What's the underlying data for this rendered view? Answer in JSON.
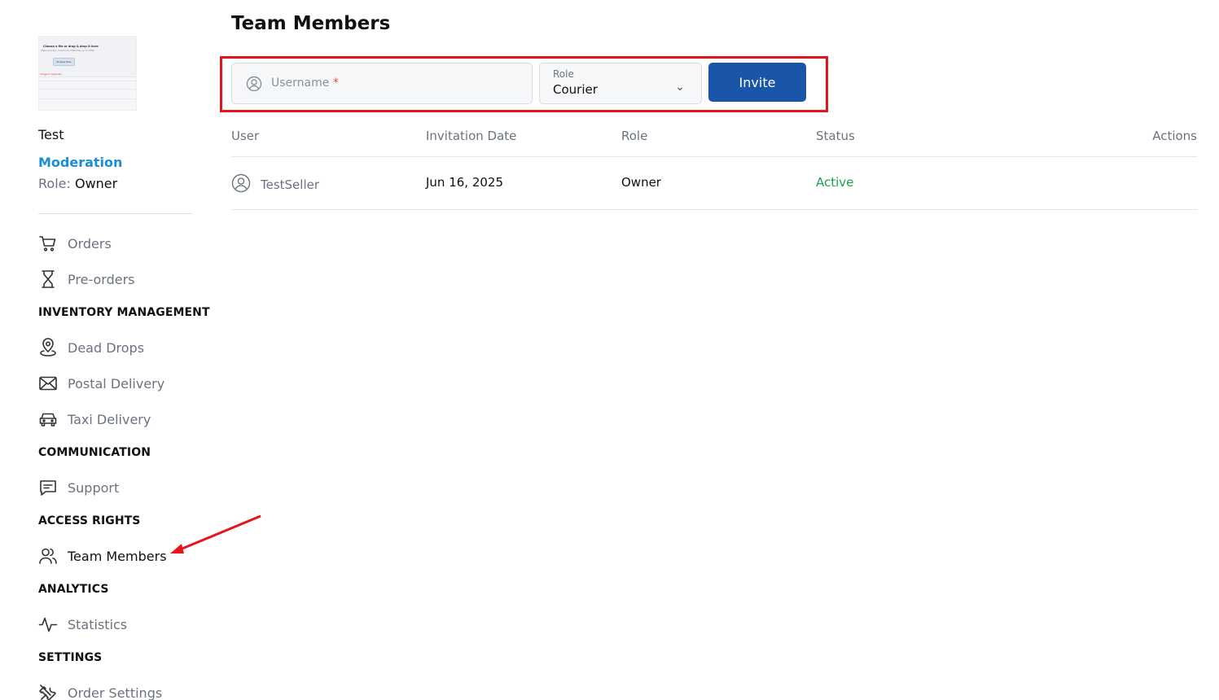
{
  "sidebar": {
    "store": {
      "thumbnail": {
        "heading": "Choose a file or drag & drop it here",
        "subtext": "PNG formats, maximum 5Mb/File up to 5MB",
        "button": "Browse files",
        "error": "Image is required"
      },
      "name": "Test",
      "status": "Moderation",
      "role_label": "Role:",
      "role_value": "Owner"
    },
    "nav": {
      "orders": {
        "label": "Orders",
        "icon": "cart-icon"
      },
      "preorders": {
        "label": "Pre-orders",
        "icon": "hourglass-icon"
      },
      "inventory_heading": "INVENTORY MANAGEMENT",
      "dead_drops": {
        "label": "Dead Drops",
        "icon": "map-pin-icon"
      },
      "postal_delivery": {
        "label": "Postal Delivery",
        "icon": "envelope-icon"
      },
      "taxi_delivery": {
        "label": "Taxi Delivery",
        "icon": "car-icon"
      },
      "communication_heading": "COMMUNICATION",
      "support": {
        "label": "Support",
        "icon": "chat-icon"
      },
      "access_heading": "ACCESS RIGHTS",
      "team_members": {
        "label": "Team Members",
        "icon": "users-icon"
      },
      "analytics_heading": "ANALYTICS",
      "statistics": {
        "label": "Statistics",
        "icon": "activity-icon"
      },
      "settings_heading": "SETTINGS",
      "order_settings": {
        "label": "Order Settings",
        "icon": "tools-icon"
      }
    }
  },
  "main": {
    "title": "Team Members",
    "invite_form": {
      "username_placeholder": "Username",
      "username_required_mark": "*",
      "role_label": "Role",
      "role_value": "Courier",
      "invite_button": "Invite"
    },
    "table": {
      "headers": {
        "user": "User",
        "invitation_date": "Invitation Date",
        "role": "Role",
        "status": "Status",
        "actions": "Actions"
      },
      "rows": [
        {
          "user": "TestSeller",
          "invitation_date": "Jun 16, 2025",
          "role": "Owner",
          "status": "Active"
        }
      ]
    }
  },
  "colors": {
    "accent": "#1a56a8",
    "moderation": "#1a8fd6",
    "active_status": "#16a34a",
    "highlight": "#e3161b"
  }
}
